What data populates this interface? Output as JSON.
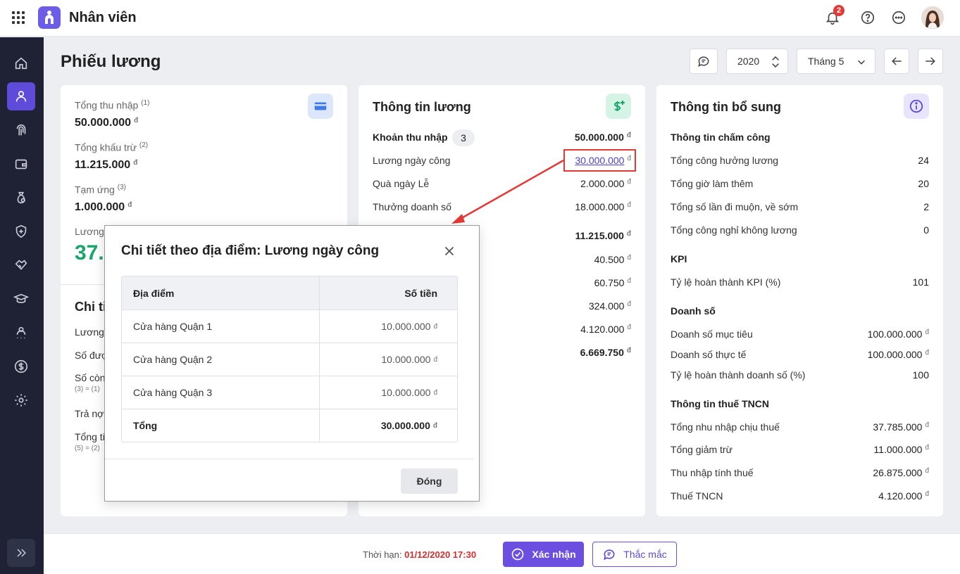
{
  "app": {
    "title": "Nhân viên",
    "notification_count": "2"
  },
  "page": {
    "title": "Phiếu lương",
    "year": "2020",
    "month": "Tháng 5"
  },
  "summary": {
    "total_income_label": "Tổng thu nhập",
    "total_income_note": "(1)",
    "total_income": "50.000.000",
    "total_deduction_label": "Tổng khấu trừ",
    "total_deduction_note": "(2)",
    "total_deduction": "11.215.000",
    "advance_label": "Tạm ứng",
    "advance_note": "(3)",
    "advance": "1.000.000",
    "net_label": "Lương",
    "net_value": "37.",
    "detail_title": "Chi ti",
    "detail_rows": [
      "Lương",
      "Số đượ",
      "Số còn",
      "Trả nợ",
      "Tổng ti"
    ],
    "detail_formulas": [
      "(3) = (1)",
      "(5) = (2)"
    ]
  },
  "salary": {
    "title": "Thông tin lương",
    "income_header": "Khoản thu nhập",
    "income_count": "3",
    "income_total": "50.000.000",
    "items": [
      {
        "label": "Lương ngày công",
        "value": "30.000.000"
      },
      {
        "label": "Quà ngày Lễ",
        "value": "2.000.000"
      },
      {
        "label": "Thưởng doanh số",
        "value": "18.000.000"
      }
    ],
    "deduction_total": "11.215.000",
    "deductions": [
      "40.500",
      "60.750",
      "324.000",
      "4.120.000",
      "6.669.750"
    ],
    "partial_char": "n"
  },
  "extra": {
    "title": "Thông tin bổ sung",
    "sections": [
      {
        "title": "Thông tin chấm công",
        "rows": [
          {
            "label": "Tổng công hưởng lương",
            "value": "24"
          },
          {
            "label": "Tổng giờ làm thêm",
            "value": "20"
          },
          {
            "label": "Tổng số lần đi muộn, về sớm",
            "value": "2"
          },
          {
            "label": "Tổng công nghỉ không lương",
            "value": "0"
          }
        ]
      },
      {
        "title": "KPI",
        "rows": [
          {
            "label": "Tỷ lệ hoàn thành KPI (%)",
            "value": "101"
          }
        ]
      },
      {
        "title": "Doanh số",
        "rows": [
          {
            "label": "Doanh số mục tiêu",
            "value": "100.000.000"
          },
          {
            "label": "Doanh số thực tế",
            "value": "100.000.000"
          },
          {
            "label": "Tỷ lệ hoàn thành doanh số (%)",
            "value": "100"
          }
        ]
      },
      {
        "title": "Thông tin thuế TNCN",
        "rows": [
          {
            "label": "Tổng nhu nhập chịu thuế",
            "value": "37.785.000"
          },
          {
            "label": "Tổng giảm trừ",
            "value": "11.000.000"
          },
          {
            "label": "Thu nhập tính thuế",
            "value": "26.875.000"
          },
          {
            "label": "Thuế TNCN",
            "value": "4.120.000"
          }
        ]
      }
    ]
  },
  "currency": "đ",
  "modal": {
    "title": "Chi tiết theo địa điểm: Lương ngày công",
    "col_location": "Địa điểm",
    "col_amount": "Số tiền",
    "rows": [
      {
        "location": "Cửa hàng Quận 1",
        "amount": "10.000.000"
      },
      {
        "location": "Cửa hàng Quận 2",
        "amount": "10.000.000"
      },
      {
        "location": "Cửa hàng Quận 3",
        "amount": "10.000.000"
      }
    ],
    "total_label": "Tổng",
    "total_amount": "30.000.000",
    "close_label": "Đóng"
  },
  "footer": {
    "deadline_label": "Thời hạn:",
    "deadline_value": "01/12/2020 17:30",
    "confirm_label": "Xác nhận",
    "ask_label": "Thắc mắc"
  },
  "colors": {
    "primary": "#6c4fe0",
    "sidebar": "#1f2235",
    "highlight": "#e53935",
    "net_value": "#1aa56b"
  }
}
